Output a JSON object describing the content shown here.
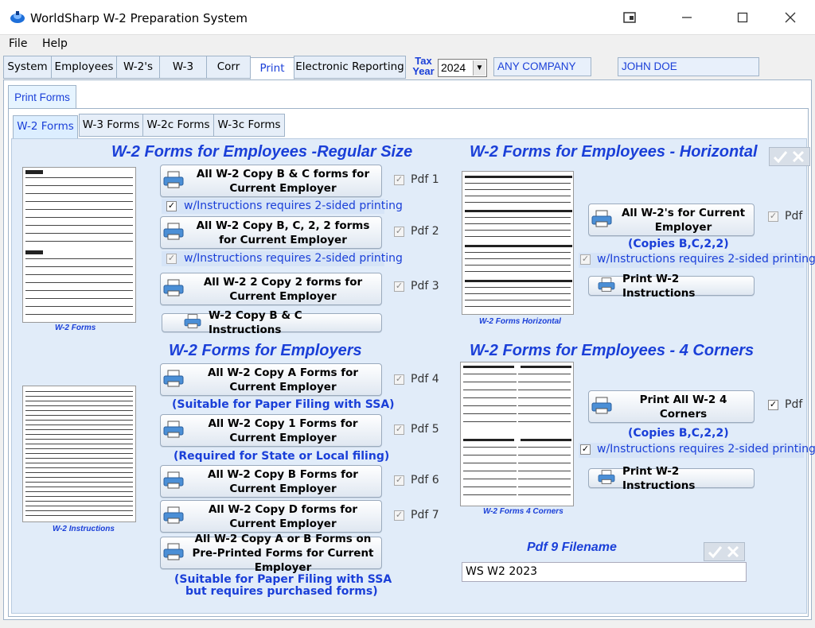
{
  "window": {
    "title": "WorldSharp W-2 Preparation System"
  },
  "menu": {
    "file": "File",
    "help": "Help"
  },
  "top_tabs": [
    "System",
    "Employees",
    "W-2's",
    "W-3",
    "Corr",
    "Print",
    "Electronic Reporting"
  ],
  "tax_year": {
    "label": "Tax Year",
    "value": "2024"
  },
  "company": "ANY COMPANY",
  "employee": "JOHN DOE",
  "print_tab": "Print Forms",
  "sub_tabs": [
    "W-2 Forms",
    "W-3 Forms",
    "W-2c Forms",
    "W-3c Forms"
  ],
  "regular": {
    "heading": "W-2 Forms for Employees -Regular Size",
    "thumb_caption": "W-2 Forms",
    "btn1": "All W-2 Copy B & C forms for Current Employer",
    "pdf1": "Pdf 1",
    "instr1": "w/Instructions requires 2-sided printing",
    "btn2": "All W-2 Copy B, C, 2, 2 forms for Current Employer",
    "pdf2": "Pdf 2",
    "instr2": "w/Instructions requires 2-sided printing",
    "btn3": "All W-2 2 Copy 2 forms for Current Employer",
    "pdf3": "Pdf 3",
    "btn_instructions": "W-2 Copy B & C Instructions"
  },
  "employers": {
    "heading": "W-2 Forms for Employers",
    "thumb_caption": "W-2 Instructions",
    "btn4": "All W-2 Copy A Forms for Current Employer",
    "pdf4": "Pdf 4",
    "note4": "(Suitable for Paper Filing with SSA)",
    "btn5": "All W-2 Copy 1 Forms for Current Employer",
    "pdf5": "Pdf 5",
    "note5": "(Required for State or Local filing)",
    "btn6": "All W-2 Copy B Forms for Current Employer",
    "pdf6": "Pdf 6",
    "btn7": "All W-2 Copy D forms for Current Employer",
    "pdf7": "Pdf 7",
    "btn8": "All W-2 Copy A or B Forms on Pre-Printed Forms for Current Employer",
    "note8a": "(Suitable for Paper Filing with SSA",
    "note8b": "but requires purchased forms)"
  },
  "horizontal": {
    "heading": "W-2 Forms for Employees - Horizontal",
    "thumb_caption": "W-2 Forms Horizontal",
    "btn": "All W-2's for Current Employer",
    "pdf": "Pdf",
    "copies": "(Copies B,C,2,2)",
    "instr": "w/Instructions requires 2-sided printing",
    "btn_instructions": "Print W-2 Instructions"
  },
  "corners": {
    "heading": "W-2 Forms for Employees - 4 Corners",
    "thumb_caption": "W-2 Forms 4 Corners",
    "btn": "Print All W-2 4 Corners",
    "pdf": "Pdf",
    "copies": "(Copies B,C,2,2)",
    "instr": "w/Instructions requires 2-sided printing",
    "btn_instructions": "Print W-2 Instructions"
  },
  "pdf9": {
    "label": "Pdf 9 Filename",
    "value": "WS W2 2023"
  },
  "colors": {
    "accent": "#1a3fd8",
    "panel": "#e1ecf9"
  }
}
